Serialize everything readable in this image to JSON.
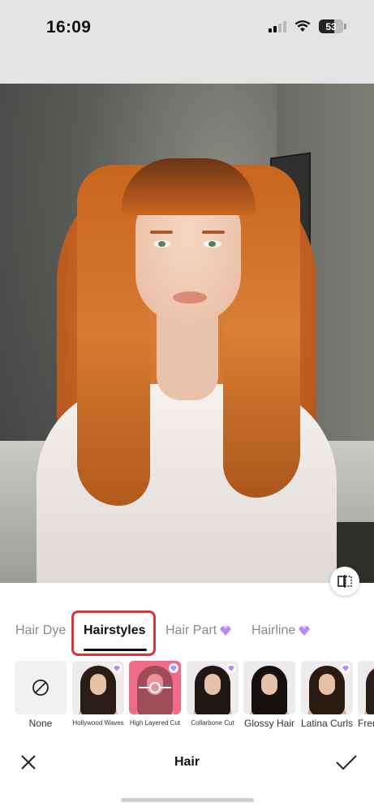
{
  "status_bar": {
    "time": "16:09",
    "battery": "53",
    "icons": [
      "signal-icon",
      "wifi-icon",
      "battery-icon"
    ]
  },
  "photo": {
    "compare_icon": "compare-icon"
  },
  "tabs": [
    {
      "label": "Hair Dye",
      "active": false,
      "premium": false
    },
    {
      "label": "Hairstyles",
      "active": true,
      "premium": false
    },
    {
      "label": "Hair Part",
      "active": false,
      "premium": true
    },
    {
      "label": "Hairline",
      "active": false,
      "premium": true
    }
  ],
  "styles": [
    {
      "label": "None",
      "icon": "none-icon",
      "selected": false,
      "premium": false
    },
    {
      "label": "Hollywood Waves",
      "selected": false,
      "premium": true
    },
    {
      "label": "High Layered Cut",
      "selected": true,
      "premium": true
    },
    {
      "label": "Collarbone Cut",
      "selected": false,
      "premium": true
    },
    {
      "label": "Glossy Hair",
      "selected": false,
      "premium": false
    },
    {
      "label": "Latina Curls",
      "selected": false,
      "premium": true
    },
    {
      "label": "Fren",
      "selected": false,
      "premium": false
    }
  ],
  "bottom_bar": {
    "title": "Hair",
    "close_icon": "close-icon",
    "confirm_icon": "checkmark-icon"
  },
  "colors": {
    "accent_highlight": "#d9353a",
    "selected_tint": "#f06b8a",
    "premium_gem": "#b58cf5"
  }
}
